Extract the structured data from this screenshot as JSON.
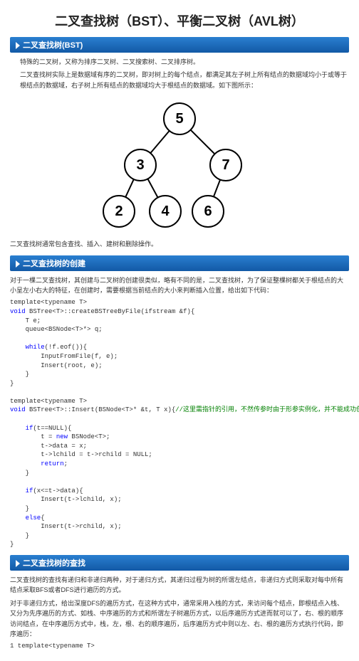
{
  "title": "二叉查找树（BST）、平衡二叉树（AVL树）",
  "s1": {
    "header": "二叉查找树(BST)",
    "p1": "特殊的二叉树，又称为排序二叉树、二叉搜索树、二叉排序树。",
    "p2": "二叉查找树实际上是数据域有序的二叉树，即对树上的每个结点，都满足其左子树上所有结点的数据域均小于或等于根结点的数据域，右子树上所有结点的数据域均大于根结点的数据域。如下图所示：",
    "p3": "二叉查找树通常包含查找、插入、建树和删除操作。"
  },
  "tree": {
    "n5": "5",
    "n3": "3",
    "n7": "7",
    "n2": "2",
    "n4": "4",
    "n6": "6"
  },
  "s2": {
    "header": "二叉查找树的创建",
    "p1": "对于一棵二叉查找树，其创建与二叉树的创建很类似，略有不同的是，二叉查找树，为了保证整棵树都关于根结点的大小呈左小右大的特征，在创建时，需要根据当前结点的大小来判断插入位置，给出如下代码：",
    "c1_l1": "template<typename T>",
    "c1_l2a": "void",
    "c1_l2b": " BSTree<T>::createBSTreeByFile(ifstream &f){",
    "c1_l3": "    T e;",
    "c1_l4": "    queue<BSNode<T>*> q;",
    "c1_blank": "",
    "c1_l5a": "    while",
    "c1_l5b": "(!f.eof()){",
    "c1_l6": "        InputFromFile(f, e);",
    "c1_l7": "        Insert(root, e);",
    "c1_l8": "    }",
    "c1_l9": "}",
    "c2_l1": "template<typename T>",
    "c2_l2a": "void",
    "c2_l2b": " BSTree<T>::Insert(BSNode<T>* &t, T x){",
    "c2_l2c": "//这里需指针的引用，不然传参时由于形参实例化，并不能成功创建二叉树",
    "c2_l3a": "    if",
    "c2_l3b": "(t==NULL){",
    "c2_l4a": "        t = ",
    "c2_l4b": "new",
    "c2_l4c": " BSNode<T>;",
    "c2_l5": "        t->data = x;",
    "c2_l6": "        t->lchild = t->rchild = NULL;",
    "c2_l7a": "        return",
    "c2_l7b": ";",
    "c2_l8": "    }",
    "c2_l9a": "    if",
    "c2_l9b": "(x<=t->data){",
    "c2_l10": "        Insert(t->lchild, x);",
    "c2_l11": "    }",
    "c2_l12a": "    else",
    "c2_l12b": "{",
    "c2_l13": "        Insert(t->rchild, x);",
    "c2_l14": "    }",
    "c2_l15": "}"
  },
  "s3": {
    "header": "二叉查找树的查找",
    "p1": "二叉查找树的查找有递归和非递归两种，对于递归方式，其递归过程为树的所谓左结点，非递归方式则采取对每中所有结点采取BFS或者DFS进行遍历的方式。",
    "p2": "对于非递归方式，给出深度DFS的遍历方式，在这种方式中，通常采用入栈的方式，来访问每个结点，即根结点入栈、又分为先序遍历的方式、如栈、中序遍历的方式和所谓左子树遍历方式，以后序遍历方式进而就可以了，右、根的顺序访问结点，在中序遍历方式中，栈，左，根、右的顺序遍历，后序遍历方式中则以左、右、根的遍历方式执行代码，即序遍历：",
    "c1": "1 template<typename T>"
  }
}
